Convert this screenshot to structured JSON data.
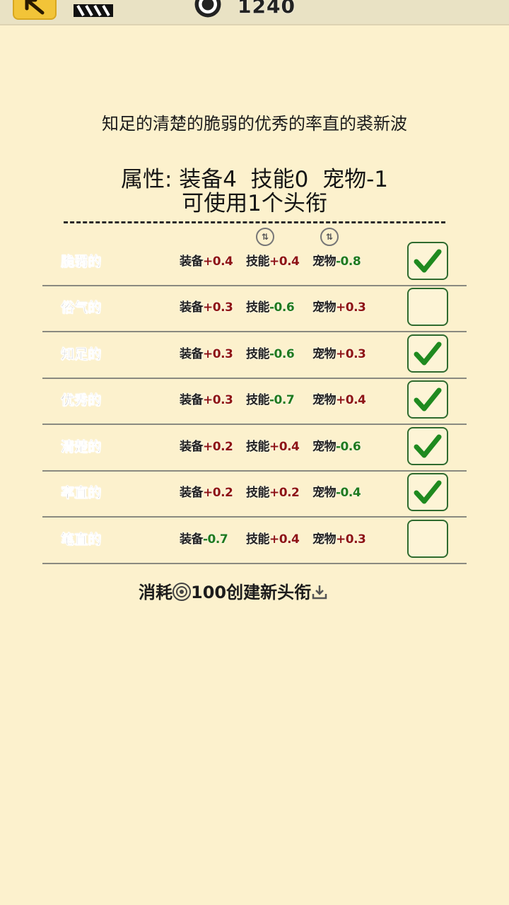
{
  "topbar": {
    "back_icon": "back-arrow-icon",
    "clapper_icon": "clapperboard-icon",
    "coin_icon": "coin-icon",
    "coins": "1240"
  },
  "header": {
    "current_title": "知足的清楚的脆弱的优秀的率直的裘新波",
    "attributes": "属性: 装备4  技能0  宠物-1",
    "usable": "可使用1个头衔"
  },
  "rows": [
    {
      "name": "脆弱的",
      "s1_label": "装备",
      "s1_val": "+0.4",
      "s2_label": "技能",
      "s2_val": "+0.4",
      "s3_label": "宠物",
      "s3_val": "-0.8",
      "checked": true
    },
    {
      "name": "俗气的",
      "s1_label": "装备",
      "s1_val": "+0.3",
      "s2_label": "技能",
      "s2_val": "-0.6",
      "s3_label": "宠物",
      "s3_val": "+0.3",
      "checked": false
    },
    {
      "name": "知足的",
      "s1_label": "装备",
      "s1_val": "+0.3",
      "s2_label": "技能",
      "s2_val": "-0.6",
      "s3_label": "宠物",
      "s3_val": "+0.3",
      "checked": true
    },
    {
      "name": "优秀的",
      "s1_label": "装备",
      "s1_val": "+0.3",
      "s2_label": "技能",
      "s2_val": "-0.7",
      "s3_label": "宠物",
      "s3_val": "+0.4",
      "checked": true
    },
    {
      "name": "清楚的",
      "s1_label": "装备",
      "s1_val": "+0.2",
      "s2_label": "技能",
      "s2_val": "+0.4",
      "s3_label": "宠物",
      "s3_val": "-0.6",
      "checked": true
    },
    {
      "name": "率直的",
      "s1_label": "装备",
      "s1_val": "+0.2",
      "s2_label": "技能",
      "s2_val": "+0.2",
      "s3_label": "宠物",
      "s3_val": "-0.4",
      "checked": true
    },
    {
      "name": "笔直的",
      "s1_label": "装备",
      "s1_val": "-0.7",
      "s2_label": "技能",
      "s2_val": "+0.4",
      "s3_label": "宠物",
      "s3_val": "+0.3",
      "checked": false
    }
  ],
  "sort_icons": [
    "sort-icon",
    "sort-icon"
  ],
  "create": {
    "prefix": "消耗",
    "cost": "100",
    "suffix": "创建新头衔",
    "coin_icon": "coin-icon",
    "download_icon": "download-icon"
  },
  "colors": {
    "positive": "#8e1414",
    "negative": "#1f7a1f",
    "background": "#fcf1cd",
    "check": "#1f8a1f"
  }
}
